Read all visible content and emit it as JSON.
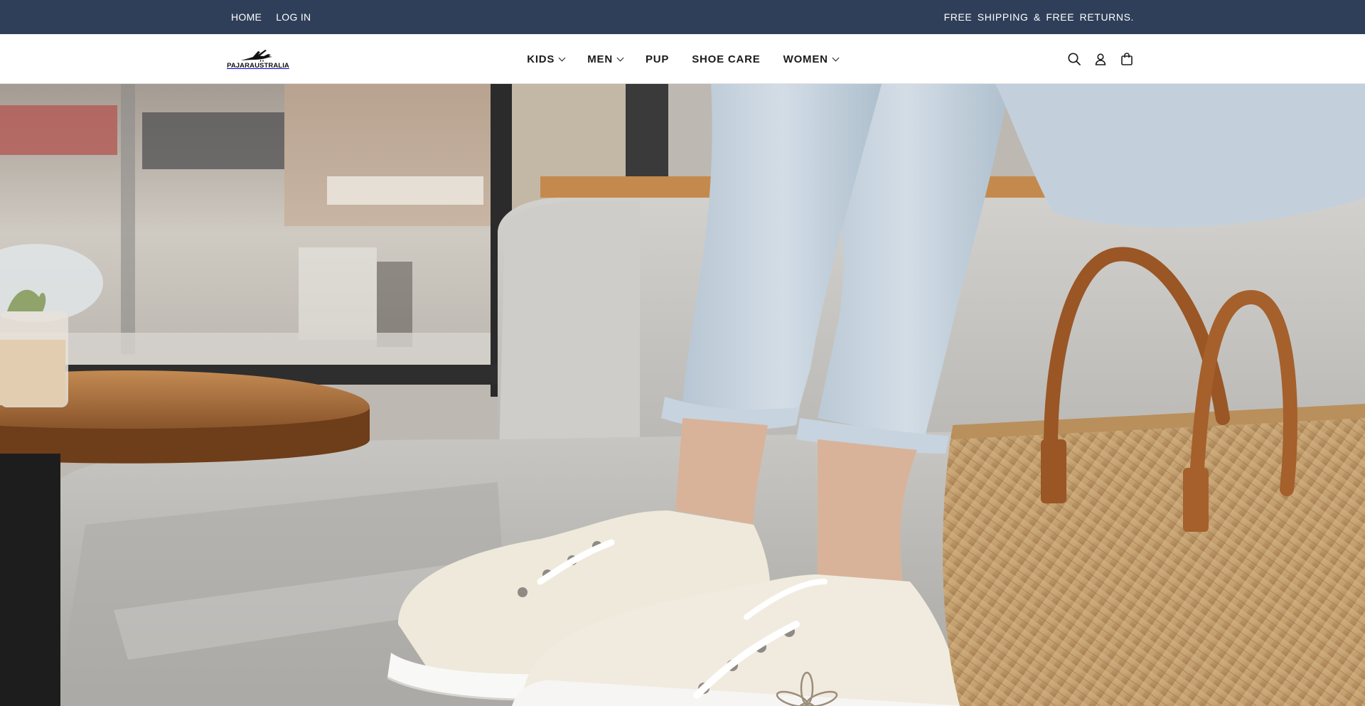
{
  "topbar": {
    "links": [
      {
        "label": "HOME"
      },
      {
        "label": "LOG IN"
      }
    ],
    "promo": "FREE SHIPPING & FREE RETURNS."
  },
  "brand": {
    "logo_text": "PAJARAUSTRALIA"
  },
  "nav": {
    "items": [
      {
        "label": "KIDS",
        "has_dropdown": true
      },
      {
        "label": "MEN",
        "has_dropdown": true
      },
      {
        "label": "PUP",
        "has_dropdown": false
      },
      {
        "label": "SHOE CARE",
        "has_dropdown": false
      },
      {
        "label": "WOMEN",
        "has_dropdown": true
      }
    ]
  },
  "actions": {
    "icons": [
      "search-icon",
      "account-icon",
      "cart-icon"
    ]
  },
  "colors": {
    "topbar_bg": "#2f3f59",
    "header_bg": "#ffffff",
    "text_dark": "#1b1b1b"
  }
}
